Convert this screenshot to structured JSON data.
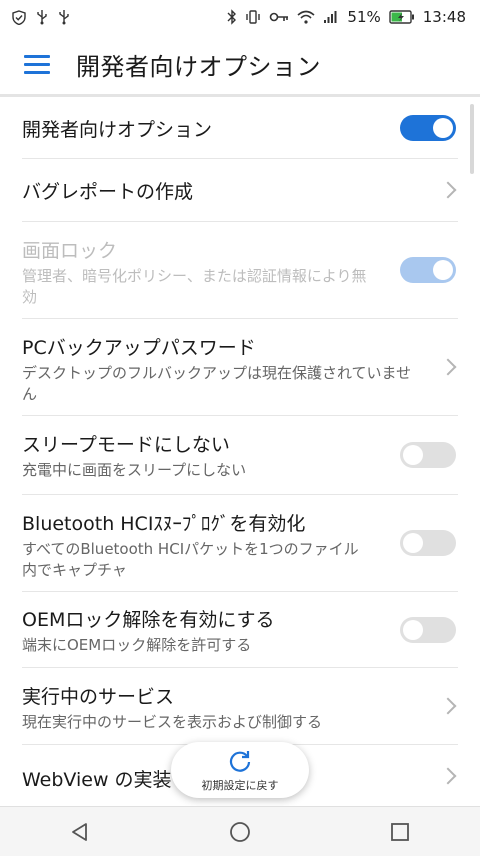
{
  "status_bar": {
    "battery_percent": "51%",
    "time": "13:48"
  },
  "app_bar": {
    "title": "開発者向けオプション"
  },
  "settings": [
    {
      "title": "開発者向けオプション",
      "subtitle": "",
      "control": "toggle",
      "state": "on",
      "enabled": true
    },
    {
      "title": "バグレポートの作成",
      "subtitle": "",
      "control": "chevron",
      "enabled": true
    },
    {
      "title": "画面ロック",
      "subtitle": "管理者、暗号化ポリシー、または認証情報により無効",
      "control": "toggle",
      "state": "on",
      "enabled": false
    },
    {
      "title": "PCバックアップパスワード",
      "subtitle": "デスクトップのフルバックアップは現在保護されていません",
      "control": "chevron",
      "enabled": true
    },
    {
      "title": "スリープモードにしない",
      "subtitle": "充電中に画面をスリープにしない",
      "control": "toggle",
      "state": "off",
      "enabled": true
    },
    {
      "title": "Bluetooth HCIｽﾇｰﾌﾟﾛｸﾞを有効化",
      "subtitle": "すべてのBluetooth HCIパケットを1つのファイル内でキャプチャ",
      "control": "toggle",
      "state": "off",
      "enabled": true
    },
    {
      "title": "OEMロック解除を有効にする",
      "subtitle": "端末にOEMロック解除を許可する",
      "control": "toggle",
      "state": "off",
      "enabled": true
    },
    {
      "title": "実行中のサービス",
      "subtitle": "現在実行中のサービスを表示および制御する",
      "control": "chevron",
      "enabled": true
    },
    {
      "title": "WebView の実装",
      "subtitle": "",
      "control": "chevron",
      "enabled": true
    }
  ],
  "reset_chip": {
    "label": "初期設定に戻す"
  },
  "colors": {
    "accent": "#1e73d8",
    "toggle_off": "#e0e0e0",
    "divider": "#e6e6e6"
  },
  "icons": {
    "status_left": [
      "shield-check-icon",
      "usb-icon",
      "usb-icon"
    ],
    "status_right": [
      "bluetooth-icon",
      "vibrate-icon",
      "key-icon",
      "wifi-icon",
      "signal-icon",
      "battery-charging-icon"
    ],
    "nav": [
      "back-triangle-icon",
      "home-circle-icon",
      "recents-square-icon"
    ]
  }
}
